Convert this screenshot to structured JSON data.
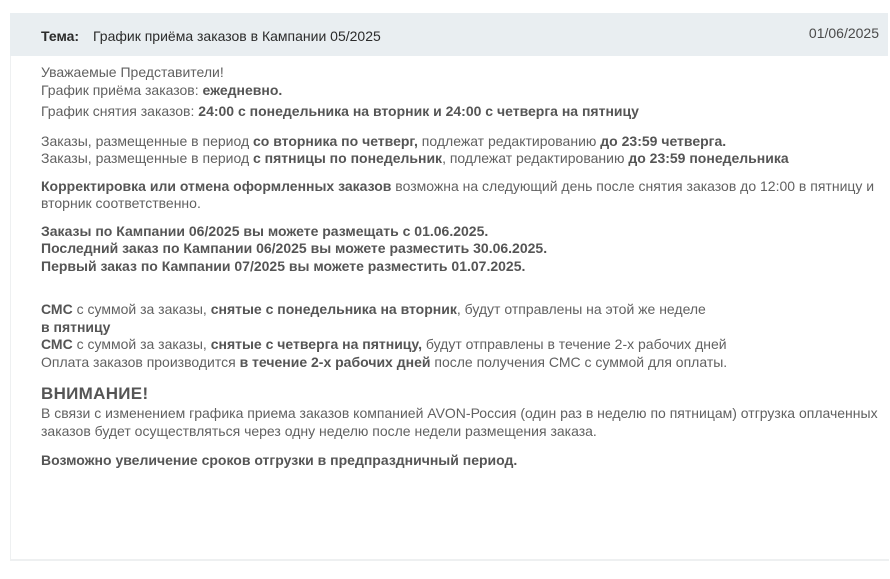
{
  "header": {
    "label": "Тема:",
    "title": "График приёма заказов в Кампании 05/2025",
    "date": "01/06/2025"
  },
  "body": {
    "greeting": "Уважаемые Представители!",
    "schedule_pre": "График приёма заказов: ",
    "schedule_bold": "ежедневно.",
    "pull_pre": "График снятия заказов: ",
    "pull_bold": "24:00 с понедельника на вторник и 24:00 с четверга на пятницу",
    "edit1_pre": "Заказы, размещенные в период ",
    "edit1_bold1": "со вторника по четверг,",
    "edit1_mid": " подлежат редактированию ",
    "edit1_bold2": "до 23:59 четверга.",
    "edit2_pre": "Заказы, размещенные в период ",
    "edit2_bold1": "с пятницы по понедельник",
    "edit2_mid": ", подлежат редактированию ",
    "edit2_bold2": "до 23:59 понедельника",
    "correct_bold": "Корректировка или отмена оформленных заказов",
    "correct_rest": " возможна на следующий день после снятия заказов до 12:00 в пятницу и вторник соответственно.",
    "campaign1": "Заказы по Кампании 06/2025 вы можете размещать с 01.06.2025.",
    "campaign2": "Последний заказ по Кампании 06/2025 вы можете разместить 30.06.2025.",
    "campaign3": "Первый заказ по Кампании 07/2025 вы можете разместить 01.07.2025.",
    "sms1_bold1": "СМС",
    "sms1_mid1": " с суммой за заказы, ",
    "sms1_bold2": "снятые с понедельника на вторник",
    "sms1_mid2": ", будут отправлены на этой же неделе ",
    "sms1_bold3": "в пятницу",
    "sms2_bold1": "СМС",
    "sms2_mid1": " с суммой за заказы, ",
    "sms2_bold2": "снятые с четверга на пятницу,",
    "sms2_mid2": " будут отправлены в течение 2-х рабочих дней",
    "pay_pre": "Оплата заказов производится ",
    "pay_bold": "в течение 2-х рабочих дней",
    "pay_post": " после получения СМС с суммой для оплаты.",
    "warn_title": "ВНИМАНИЕ!",
    "warn_text": "В связи с изменением графика приема заказов компанией AVON-Россия (один раз в неделю по пятницам) отгрузка оплаченных заказов будет осуществляться через одну неделю после недели размещения заказа.",
    "holiday": "Возможно увеличение сроков отгрузки в предпраздничный период."
  }
}
